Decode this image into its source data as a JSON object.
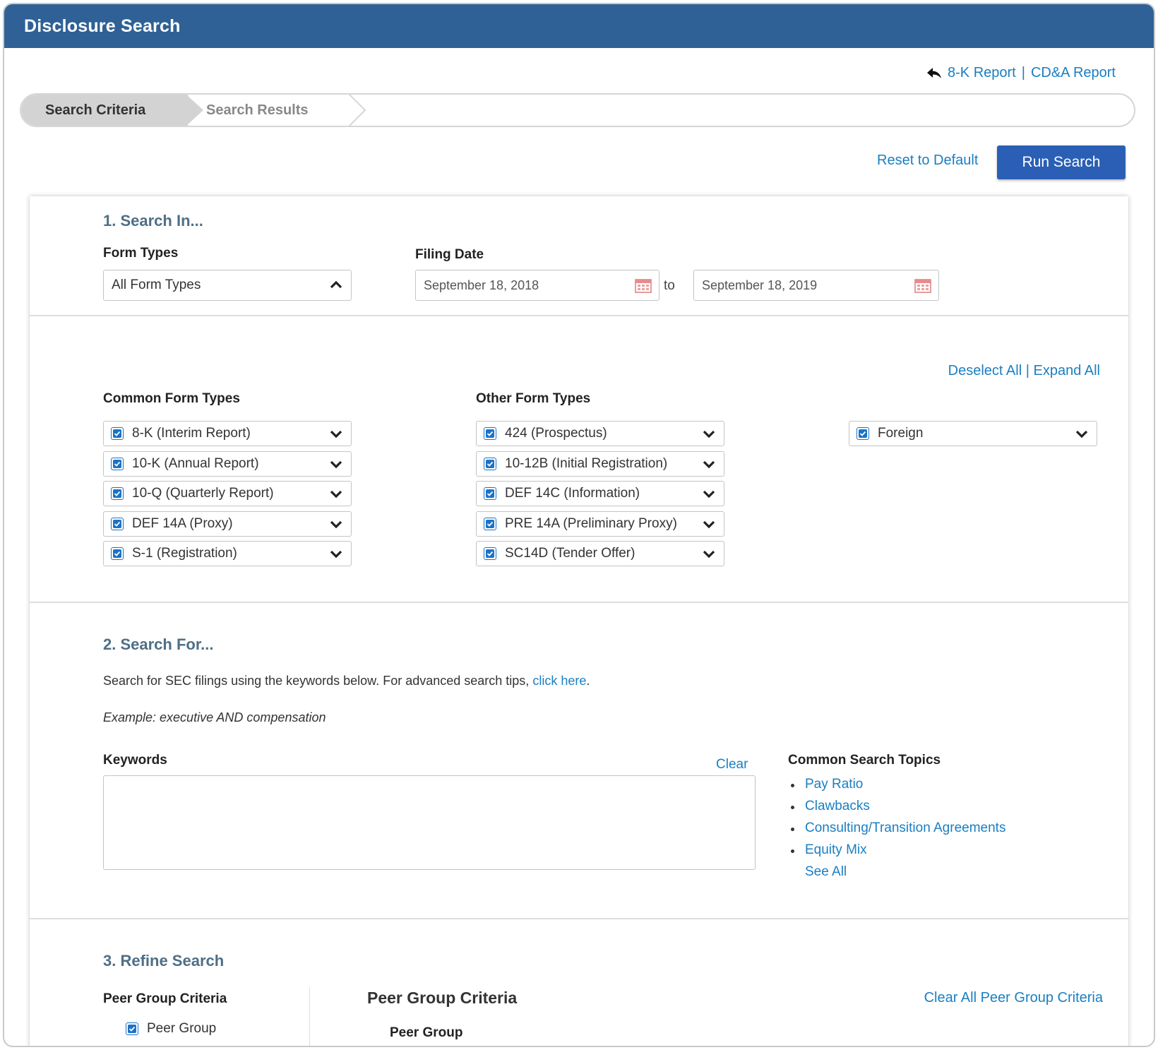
{
  "window": {
    "title": "Disclosure Search"
  },
  "top_links": {
    "report_8k": "8-K Report",
    "separator": "|",
    "report_cda": "CD&A Report",
    "back_icon": "reply-arrow-icon"
  },
  "breadcrumb": {
    "step1": "Search Criteria",
    "step2": "Search Results"
  },
  "actions": {
    "reset": "Reset to Default",
    "run": "Run Search"
  },
  "section1": {
    "heading": "1. Search In...",
    "form_types_label": "Form Types",
    "form_types_value": "All Form Types",
    "filing_date_label": "Filing Date",
    "date_from": "September 18, 2018",
    "date_to_label": "to",
    "date_to": "September 18, 2019",
    "deselect_all": "Deselect All",
    "link_separator": "|",
    "expand_all": "Expand All",
    "common_label": "Common Form Types",
    "other_label": "Other Form Types",
    "common_types": [
      {
        "label": "8-K (Interim Report)",
        "checked": true
      },
      {
        "label": "10-K (Annual Report)",
        "checked": true
      },
      {
        "label": "10-Q (Quarterly Report)",
        "checked": true
      },
      {
        "label": "DEF 14A (Proxy)",
        "checked": true
      },
      {
        "label": "S-1 (Registration)",
        "checked": true
      }
    ],
    "other_types": [
      {
        "label": "424 (Prospectus)",
        "checked": true
      },
      {
        "label": "10-12B (Initial Registration)",
        "checked": true
      },
      {
        "label": "DEF 14C (Information)",
        "checked": true
      },
      {
        "label": "PRE 14A (Preliminary Proxy)",
        "checked": true
      },
      {
        "label": "SC14D (Tender Offer)",
        "checked": true
      }
    ],
    "foreign": {
      "label": "Foreign",
      "checked": true
    }
  },
  "section2": {
    "heading": "2. Search For...",
    "description": "Search for SEC filings using the keywords below. For advanced search tips,",
    "tips_link": "click here",
    "description_end": ".",
    "example": "Example: executive AND compensation",
    "keywords_label": "Keywords",
    "clear": "Clear",
    "keywords_value": "",
    "topics_label": "Common Search Topics",
    "topics": [
      "Pay Ratio",
      "Clawbacks",
      "Consulting/Transition Agreements",
      "Equity Mix"
    ],
    "see_all": "See All"
  },
  "section3": {
    "heading": "3. Refine Search",
    "left_label": "Peer Group Criteria",
    "peer_group_checkbox": "Peer Group",
    "right_title": "Peer Group Criteria",
    "clear_all": "Clear All Peer Group Criteria",
    "peer_group_label": "Peer Group"
  },
  "colors": {
    "title_bar": "#2f6196",
    "link": "#1a7fc1",
    "button": "#2a5fb5",
    "section_heading": "#4e6f86"
  }
}
